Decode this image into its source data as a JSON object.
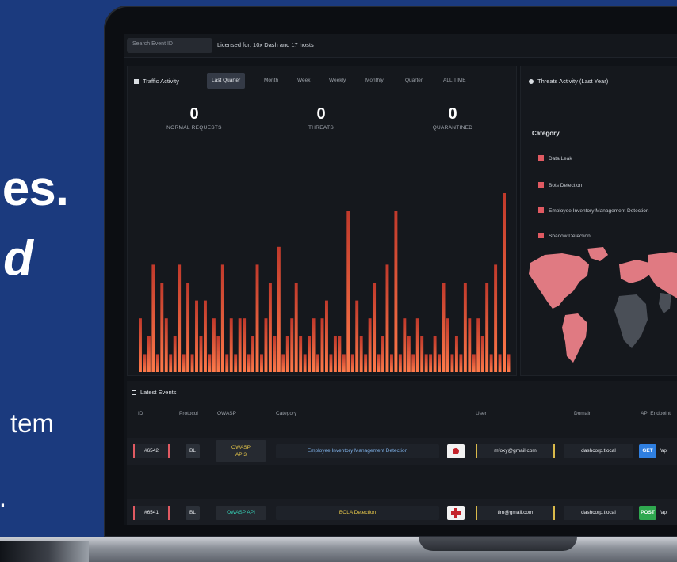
{
  "hero": {
    "line1": "es.",
    "line2": "d",
    "body1": "tem",
    "body2": "."
  },
  "topbar": {
    "search_placeholder": "Search Event ID",
    "license": "Licensed for: 10x Dash and 17 hosts"
  },
  "traffic": {
    "title": "Traffic Activity",
    "filters": [
      "Last Quarter",
      "Month",
      "Week",
      "Weekly",
      "Monthly",
      "Quarter",
      "ALL TIME"
    ],
    "active_filter": 0,
    "stats": [
      {
        "value": "0",
        "label": "NORMAL REQUESTS"
      },
      {
        "value": "0",
        "label": "THREATS"
      },
      {
        "value": "0",
        "label": "QUARANTINED"
      }
    ]
  },
  "chart_data": {
    "type": "bar",
    "title": "",
    "xlabel": "",
    "ylabel": "",
    "ylim": [
      0,
      10
    ],
    "grid": false,
    "values": [
      3,
      1,
      2,
      6,
      1,
      5,
      3,
      1,
      2,
      6,
      1,
      5,
      1,
      4,
      2,
      4,
      1,
      3,
      2,
      6,
      1,
      3,
      1,
      3,
      3,
      1,
      2,
      6,
      1,
      3,
      5,
      2,
      7,
      1,
      2,
      3,
      5,
      2,
      1,
      2,
      3,
      1,
      3,
      4,
      1,
      2,
      2,
      1,
      9,
      1,
      4,
      2,
      1,
      3,
      5,
      1,
      2,
      6,
      1,
      9,
      1,
      3,
      2,
      1,
      3,
      2,
      1,
      1,
      2,
      1,
      5,
      3,
      1,
      2,
      1,
      5,
      3,
      1,
      3,
      2,
      5,
      1,
      6,
      1,
      10,
      1
    ]
  },
  "map": {
    "title": "Threats Activity (Last Year)",
    "category_label": "Category",
    "legend": [
      "Data Leak",
      "Bots Detection",
      "Employee Inventory Management Detection",
      "Shadow Detection"
    ],
    "color_active": "#e07a82",
    "color_inactive": "#4a4f57"
  },
  "events": {
    "title": "Latest Events",
    "columns": [
      "ID",
      "Protocol",
      "OWASP",
      "Category",
      "User",
      "Domain",
      "API Endpoint"
    ],
    "rows": [
      {
        "id": "#6542",
        "protocol": "BL",
        "owasp_line1": "OWASP",
        "owasp_line2": "API3",
        "owasp_color": "#e9c94a",
        "category": "Employee Inventory Management Detection",
        "category_color": "#7fb1e8",
        "user": "mfoxy@gmail.com",
        "domain": "dashcorp.tlocal",
        "method": "GET",
        "method_color": "#2f7fe0",
        "endpoint": "/api"
      },
      {
        "id": "#6541",
        "protocol": "BL",
        "owasp_line1": "OWASP API",
        "owasp_line2": "",
        "owasp_color": "#35d0b6",
        "category": "BOLA Detection",
        "category_color": "#e9c94a",
        "user": "tim@gmail.com",
        "domain": "dashcorp.tlocal",
        "method": "POST",
        "method_color": "#2fa84f",
        "endpoint": "/api"
      }
    ]
  }
}
